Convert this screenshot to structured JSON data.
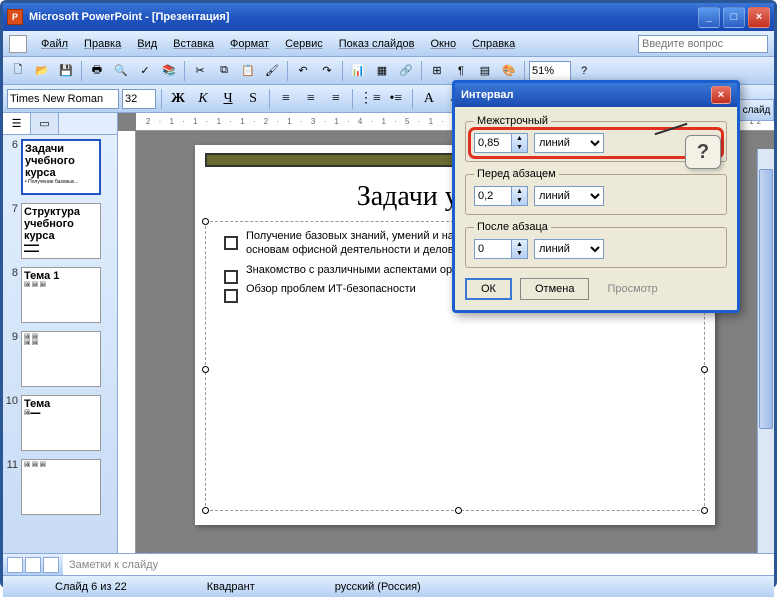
{
  "window": {
    "app": "Microsoft PowerPoint",
    "doc": "[Презентация]"
  },
  "menu": {
    "file": "Файл",
    "edit": "Правка",
    "view": "Вид",
    "insert": "Вставка",
    "format": "Формат",
    "tools": "Сервис",
    "slideshow": "Показ слайдов",
    "window": "Окно",
    "help": "Справка"
  },
  "help_box": {
    "placeholder": "Введите вопрос"
  },
  "format_bar": {
    "font": "Times New Roman",
    "size": "32",
    "zoom": "51%"
  },
  "thumbs": {
    "visible": [
      6,
      7,
      8,
      9,
      10,
      11
    ],
    "selected": 6
  },
  "ruler": "2 · 1 · 1 · 1 · 1 · 2 · 1 · 3 · 1 · 4 · 1 · 5 · 1 · 6 · 1 · 7 · 1 · 8 · 1 · 9 · 1 · 10 · 1 · 11 · 1 · 12",
  "slide": {
    "title": "Задачи учебного курса",
    "title_visible": "Задачи учебного",
    "bullets": [
      "Получение базовых знаний, умений и навыков по информационным технологиям, основам офисной деятельности и делового общения",
      "Знакомство с различными аспектами организации офисной деятельности",
      "Обзор проблем ИТ-безопасности"
    ]
  },
  "taskpane_tab": "і слайд",
  "notes": "Заметки к слайду",
  "status": {
    "slide": "Слайд 6 из 22",
    "layout": "Квадрант",
    "lang": "русский (Россия)"
  },
  "dialog": {
    "title": "Интервал",
    "groups": {
      "line": "Межстрочный",
      "before": "Перед абзацем",
      "after": "После абзаца"
    },
    "line": {
      "value": "0,85",
      "unit": "линий"
    },
    "before": {
      "value": "0,2",
      "unit": "линий"
    },
    "after": {
      "value": "0",
      "unit": "линий"
    },
    "ok": "ОК",
    "cancel": "Отмена",
    "preview": "Просмотр",
    "callout": "?"
  }
}
